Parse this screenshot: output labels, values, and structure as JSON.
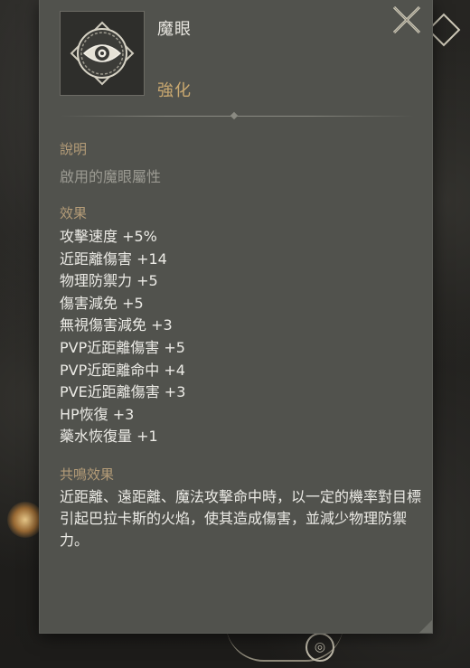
{
  "item": {
    "name": "魔眼",
    "type": "強化",
    "icon": "eye-emblem-icon"
  },
  "description": {
    "title": "說明",
    "text": "啟用的魔眼屬性"
  },
  "effects": {
    "title": "效果",
    "items": [
      "攻擊速度 +5%",
      "近距離傷害 +14",
      "物理防禦力 +5",
      "傷害減免 +5",
      "無視傷害減免 +3",
      "PVP近距離傷害 +5",
      "PVP近距離命中 +4",
      "PVE近距離傷害 +3",
      "HP恢復 +3",
      "藥水恢復量 +1"
    ]
  },
  "resonance": {
    "title": "共鳴效果",
    "text": "近距離、遠距離、魔法攻擊命中時，以一定的機率對目標引起巴拉卡斯的火焰，使其造成傷害，並減少物理防禦力。"
  },
  "colors": {
    "panel": "#51524d",
    "section_title": "#b49c78",
    "item_type": "#c9a870",
    "text": "#ecebe6",
    "muted_text": "#9b9a92"
  }
}
